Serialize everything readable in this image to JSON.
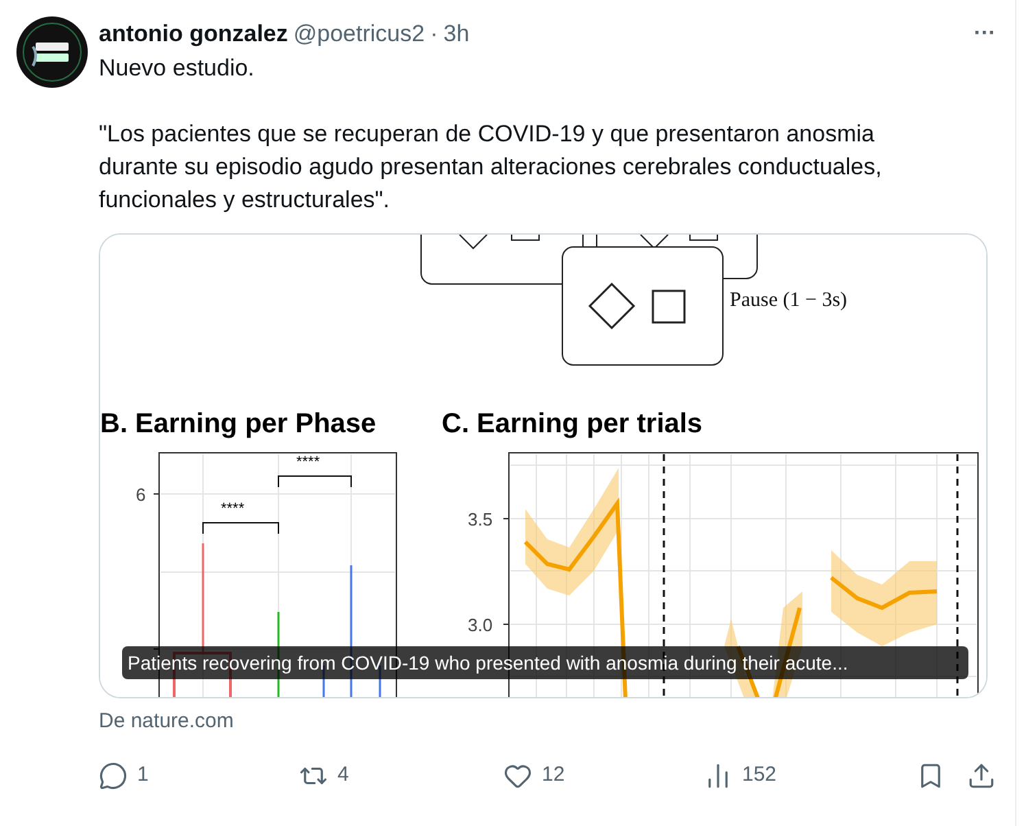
{
  "post": {
    "author": "antonio gonzalez",
    "handle": "@poetricus2",
    "separator": "·",
    "time": "3h",
    "more": "···",
    "paragraphs": [
      "Nuevo estudio.",
      "\"Los pacientes que se recuperan de COVID-19 y que presentaron anosmia durante su episodio agudo presentan alteraciones cerebrales conductuales, funcionales y estructurales\"."
    ]
  },
  "card": {
    "figure": {
      "pause_label": "Pause (1 − 3s)",
      "panels": [
        {
          "title": "B. Earning per Phase",
          "ticks": [
            "6"
          ],
          "brackets": [
            "****",
            "****"
          ]
        },
        {
          "title": "C. Earning per trials",
          "ticks": [
            "3.5",
            "3.0"
          ]
        }
      ]
    },
    "caption": "Patients recovering from COVID-19 who presented with anosmia during their acute...",
    "source": "De nature.com"
  },
  "actions": [
    {
      "kind": "reply",
      "count": "1"
    },
    {
      "kind": "repost",
      "count": "4"
    },
    {
      "kind": "like",
      "count": "12"
    },
    {
      "kind": "views",
      "count": "152"
    },
    {
      "kind": "bookmark"
    },
    {
      "kind": "share"
    }
  ]
}
